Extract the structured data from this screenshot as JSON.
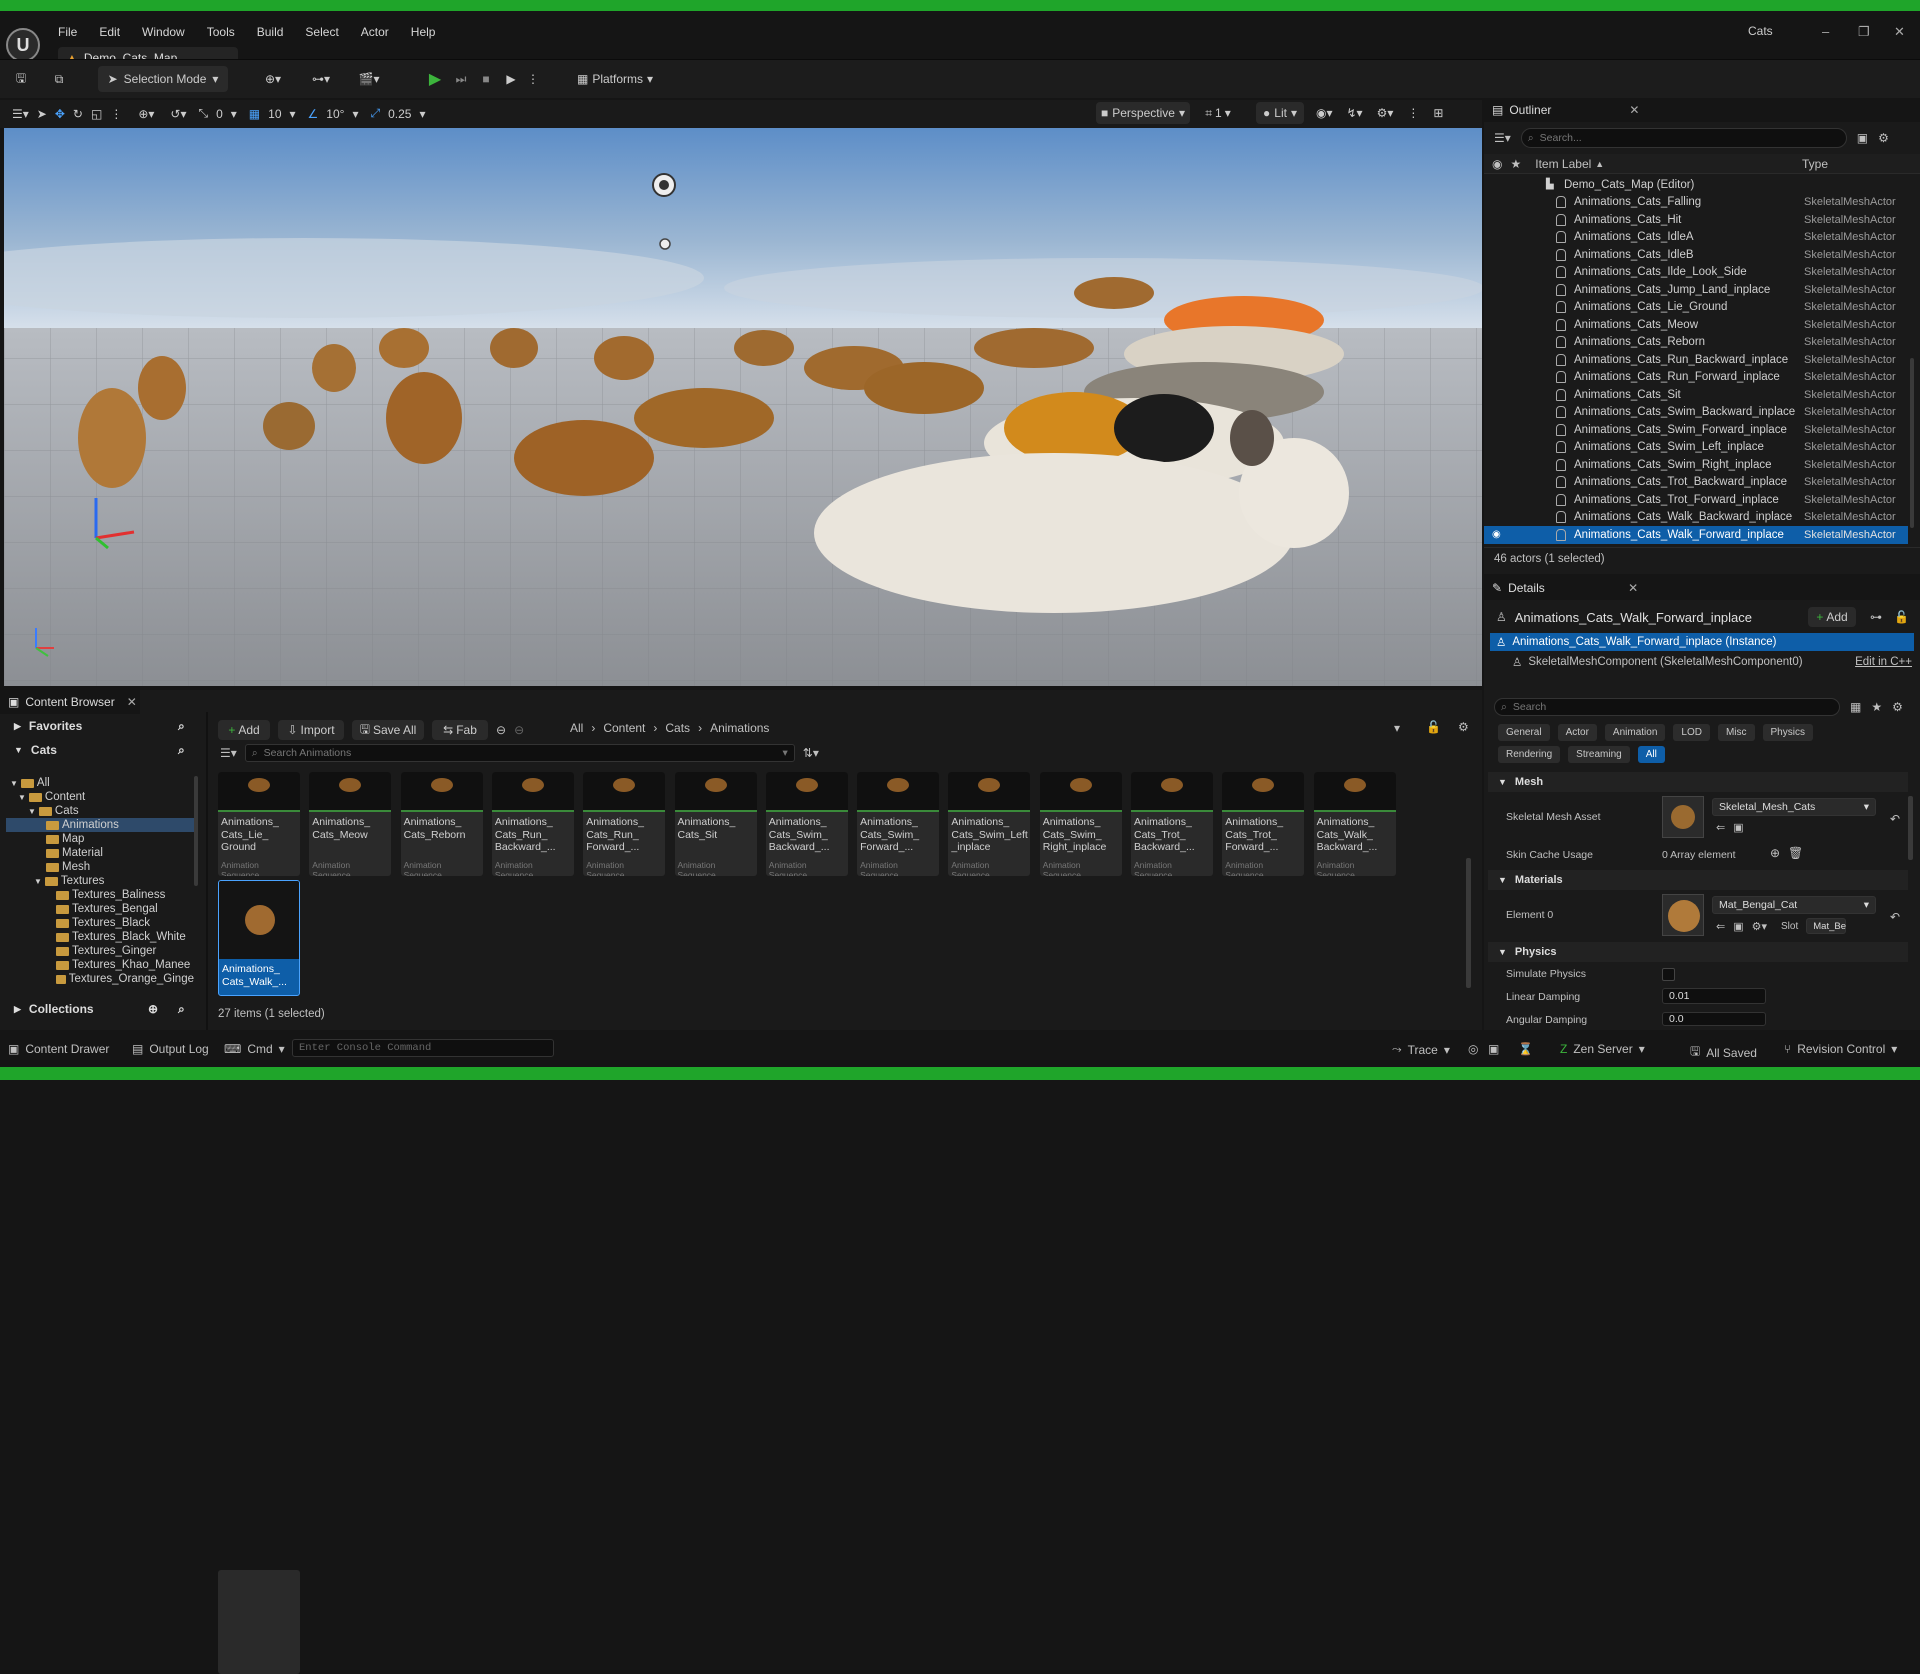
{
  "window": {
    "title": "Cats",
    "minimize": "–",
    "restore": "❐",
    "close": "✕"
  },
  "menu": [
    "File",
    "Edit",
    "Window",
    "Tools",
    "Build",
    "Select",
    "Actor",
    "Help"
  ],
  "map_tab": "Demo_Cats_Map",
  "toolbar": {
    "selection_mode": "Selection Mode",
    "platforms": "Platforms"
  },
  "viewport_bar": {
    "translate_snap": "0",
    "grid_snap": "10",
    "rotate_snap": "10°",
    "scale_snap": "0.25",
    "perspective": "Perspective",
    "cam_speed": "1",
    "lit": "Lit"
  },
  "outliner": {
    "tab": "Outliner",
    "search_placeholder": "Search...",
    "col_label": "Item Label",
    "col_type": "Type",
    "root": "Demo_Cats_Map (Editor)",
    "items": [
      {
        "name": "Animations_Cats_Falling",
        "type": "SkeletalMeshActor"
      },
      {
        "name": "Animations_Cats_Hit",
        "type": "SkeletalMeshActor"
      },
      {
        "name": "Animations_Cats_IdleA",
        "type": "SkeletalMeshActor"
      },
      {
        "name": "Animations_Cats_IdleB",
        "type": "SkeletalMeshActor"
      },
      {
        "name": "Animations_Cats_Ilde_Look_Side",
        "type": "SkeletalMeshActor"
      },
      {
        "name": "Animations_Cats_Jump_Land_inplace",
        "type": "SkeletalMeshActor"
      },
      {
        "name": "Animations_Cats_Lie_Ground",
        "type": "SkeletalMeshActor"
      },
      {
        "name": "Animations_Cats_Meow",
        "type": "SkeletalMeshActor"
      },
      {
        "name": "Animations_Cats_Reborn",
        "type": "SkeletalMeshActor"
      },
      {
        "name": "Animations_Cats_Run_Backward_inplace",
        "type": "SkeletalMeshActor"
      },
      {
        "name": "Animations_Cats_Run_Forward_inplace",
        "type": "SkeletalMeshActor"
      },
      {
        "name": "Animations_Cats_Sit",
        "type": "SkeletalMeshActor"
      },
      {
        "name": "Animations_Cats_Swim_Backward_inplace",
        "type": "SkeletalMeshActor"
      },
      {
        "name": "Animations_Cats_Swim_Forward_inplace",
        "type": "SkeletalMeshActor"
      },
      {
        "name": "Animations_Cats_Swim_Left_inplace",
        "type": "SkeletalMeshActor"
      },
      {
        "name": "Animations_Cats_Swim_Right_inplace",
        "type": "SkeletalMeshActor"
      },
      {
        "name": "Animations_Cats_Trot_Backward_inplace",
        "type": "SkeletalMeshActor"
      },
      {
        "name": "Animations_Cats_Trot_Forward_inplace",
        "type": "SkeletalMeshActor"
      },
      {
        "name": "Animations_Cats_Walk_Backward_inplace",
        "type": "SkeletalMeshActor"
      },
      {
        "name": "Animations_Cats_Walk_Forward_inplace",
        "type": "SkeletalMeshActor"
      }
    ],
    "footer": "46 actors (1 selected)"
  },
  "details": {
    "tab": "Details",
    "actor_name": "Animations_Cats_Walk_Forward_inplace",
    "add": "Add",
    "instance": "Animations_Cats_Walk_Forward_inplace (Instance)",
    "component": "SkeletalMeshComponent (SkeletalMeshComponent0)",
    "edit_cpp": "Edit in C++",
    "search_placeholder": "Search",
    "filters_row1": [
      "General",
      "Actor",
      "Animation",
      "LOD",
      "Misc",
      "Physics"
    ],
    "filters_row2": [
      "Rendering",
      "Streaming",
      "All"
    ],
    "sec_mesh": "Mesh",
    "skeletal_mesh_asset_label": "Skeletal Mesh Asset",
    "skeletal_mesh_asset_value": "Skeletal_Mesh_Cats",
    "skin_cache_label": "Skin Cache Usage",
    "skin_cache_value": "0 Array element",
    "sec_materials": "Materials",
    "element0_label": "Element 0",
    "element0_value": "Mat_Bengal_Cat",
    "slot_label": "Slot",
    "slot_value": "Mat_Be",
    "sec_physics": "Physics",
    "simulate_label": "Simulate Physics",
    "linear_label": "Linear Damping",
    "linear_value": "0.01",
    "angular_label": "Angular Damping",
    "angular_value": "0.0"
  },
  "content_browser": {
    "tab": "Content Browser",
    "favorites": "Favorites",
    "cats": "Cats",
    "add": "Add",
    "import": "Import",
    "save_all": "Save All",
    "fab": "Fab",
    "path": [
      "All",
      "Content",
      "Cats",
      "Animations"
    ],
    "search_placeholder": "Search Animations",
    "tree": [
      "All",
      "Content",
      "Cats",
      "Animations",
      "Map",
      "Material",
      "Mesh",
      "Textures",
      "Textures_Baliness",
      "Textures_Bengal",
      "Textures_Black",
      "Textures_Black_White",
      "Textures_Ginger",
      "Textures_Khao_Manee",
      "Textures_Orange_Ginge"
    ],
    "collections": "Collections",
    "assets": [
      {
        "l1": "Animations_",
        "l2": "Cats_Lie_",
        "l3": "Ground"
      },
      {
        "l1": "Animations_",
        "l2": "Cats_Meow",
        "l3": ""
      },
      {
        "l1": "Animations_",
        "l2": "Cats_Reborn",
        "l3": ""
      },
      {
        "l1": "Animations_",
        "l2": "Cats_Run_",
        "l3": "Backward_..."
      },
      {
        "l1": "Animations_",
        "l2": "Cats_Run_",
        "l3": "Forward_..."
      },
      {
        "l1": "Animations_",
        "l2": "Cats_Sit",
        "l3": ""
      },
      {
        "l1": "Animations_",
        "l2": "Cats_Swim_",
        "l3": "Backward_..."
      },
      {
        "l1": "Animations_",
        "l2": "Cats_Swim_",
        "l3": "Forward_..."
      },
      {
        "l1": "Animations_",
        "l2": "Cats_Swim_Left",
        "l3": "_inplace"
      },
      {
        "l1": "Animations_",
        "l2": "Cats_Swim_",
        "l3": "Right_inplace"
      },
      {
        "l1": "Animations_",
        "l2": "Cats_Trot_",
        "l3": "Backward_..."
      },
      {
        "l1": "Animations_",
        "l2": "Cats_Trot_",
        "l3": "Forward_..."
      },
      {
        "l1": "Animations_",
        "l2": "Cats_Walk_",
        "l3": "Backward_..."
      }
    ],
    "asset_type": "Animation Sequence",
    "selected_asset": {
      "l1": "Animations_",
      "l2": "Cats_Walk_..."
    },
    "footer": "27 items (1 selected)"
  },
  "statusbar": {
    "content_drawer": "Content Drawer",
    "output_log": "Output Log",
    "cmd": "Cmd",
    "console_placeholder": "Enter Console Command",
    "trace": "Trace",
    "zen": "Zen Server",
    "saved": "All Saved",
    "revision": "Revision Control"
  },
  "colors": {
    "accent": "#0e5ea8",
    "brand_green": "#1fa52a",
    "play_green": "#3cb43c",
    "folder": "#c89a3e"
  }
}
